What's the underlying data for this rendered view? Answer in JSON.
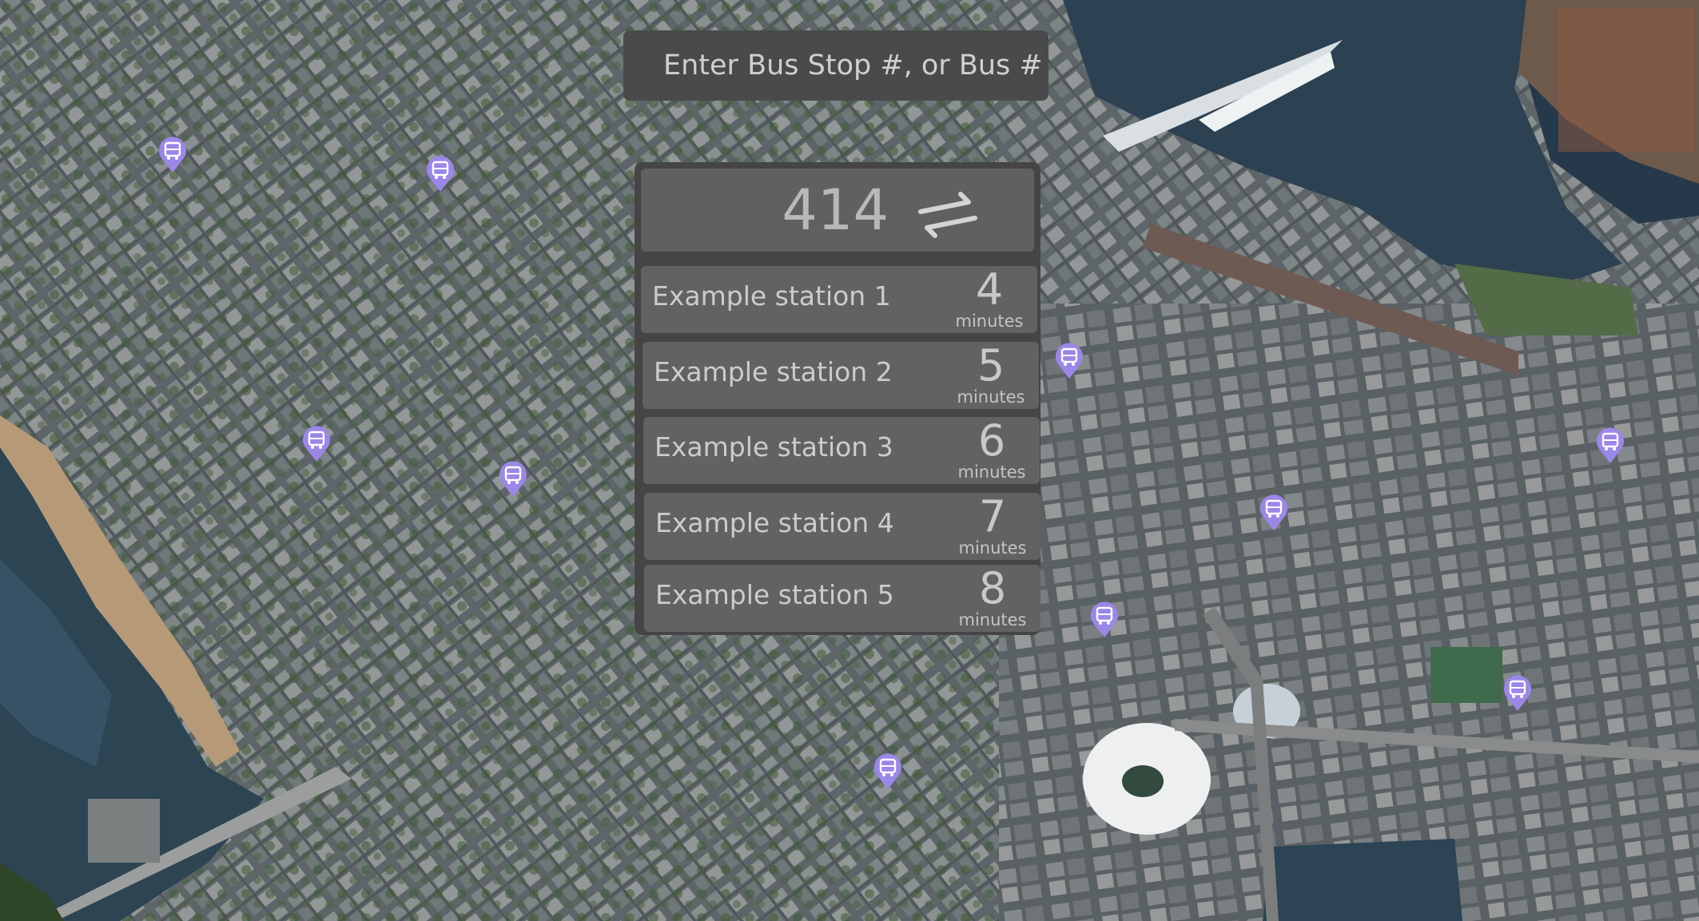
{
  "search": {
    "placeholder": "Enter Bus Stop #, or Bus #"
  },
  "route": {
    "number": "414",
    "swap_icon": "swap-direction-icon"
  },
  "stops": [
    {
      "name": "Example station 1",
      "eta": "4",
      "unit": "minutes"
    },
    {
      "name": "Example station 2",
      "eta": "5",
      "unit": "minutes"
    },
    {
      "name": "Example station 3",
      "eta": "6",
      "unit": "minutes"
    },
    {
      "name": "Example station 4",
      "eta": "7",
      "unit": "minutes"
    },
    {
      "name": "Example station 5",
      "eta": "8",
      "unit": "minutes"
    }
  ],
  "map": {
    "marker_icon": "bus-stop-marker-icon",
    "marker_color": "#9b87e8",
    "water_color": "#2c4150",
    "city_color": "#6b7274"
  }
}
